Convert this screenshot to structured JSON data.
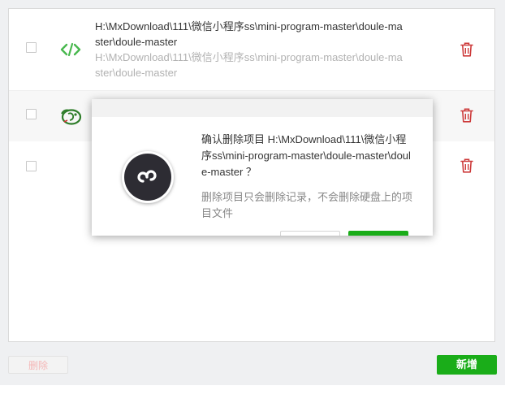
{
  "projects": [
    {
      "path": "H:\\MxDownload\\111\\微信小程序ss\\mini-program-master\\doule-master\\doule-master",
      "subpath": "H:\\MxDownload\\111\\微信小程序ss\\mini-program-master\\doule-master\\doule-master",
      "icon": "code-icon"
    },
    {
      "path": "",
      "subpath": "",
      "icon": "app-logo-icon"
    },
    {
      "path": "",
      "subpath": "",
      "icon": ""
    }
  ],
  "footer": {
    "delete_label": "删除",
    "add_label": "新增"
  },
  "dialog": {
    "message": "确认删除项目 H:\\MxDownload\\111\\微信小程序ss\\mini-program-master\\doule-master\\doule-master ？",
    "note": "删除项目只会删除记录，不会删除硬盘上的项目文件",
    "cancel_label": "",
    "confirm_label": ""
  },
  "colors": {
    "accent_green": "#1aad19",
    "trash_red": "#cd3a3a",
    "code_icon_green": "#48b84e",
    "background": "#eff0f2"
  }
}
